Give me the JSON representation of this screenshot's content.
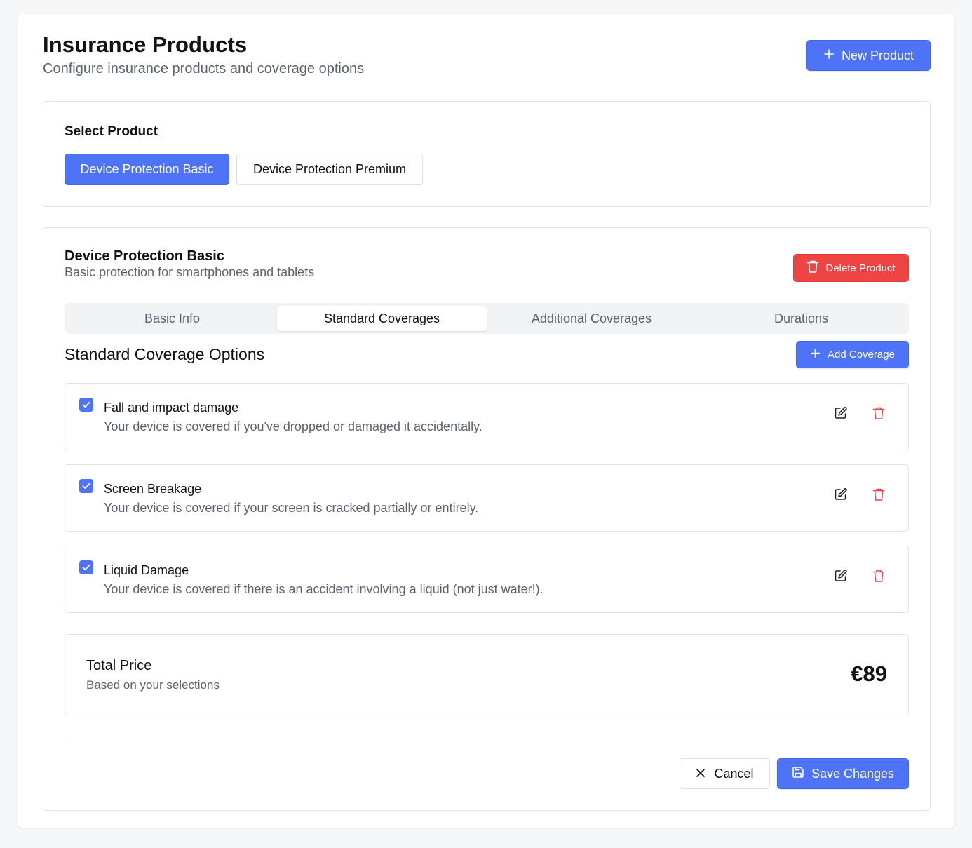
{
  "header": {
    "title": "Insurance Products",
    "subtitle": "Configure insurance products and coverage options",
    "new_product_label": "New Product"
  },
  "select_product": {
    "label": "Select Product",
    "options": [
      "Device Protection Basic",
      "Device Protection Premium"
    ],
    "selected": "Device Protection Basic"
  },
  "product": {
    "name": "Device Protection Basic",
    "description": "Basic protection for smartphones and tablets",
    "delete_label": "Delete Product"
  },
  "tabs": [
    {
      "label": "Basic Info",
      "active": false
    },
    {
      "label": "Standard Coverages",
      "active": true
    },
    {
      "label": "Additional Coverages",
      "active": false
    },
    {
      "label": "Durations",
      "active": false
    }
  ],
  "coverage_section": {
    "title": "Standard Coverage Options",
    "add_label": "Add Coverage",
    "items": [
      {
        "title": "Fall and impact damage",
        "description": "Your device is covered if you've dropped or damaged it accidentally.",
        "checked": true
      },
      {
        "title": "Screen Breakage",
        "description": "Your device is covered if your screen is cracked partially or entirely.",
        "checked": true
      },
      {
        "title": "Liquid Damage",
        "description": "Your device is covered if there is an accident involving a liquid (not just water!).",
        "checked": true
      }
    ]
  },
  "total": {
    "title": "Total Price",
    "subtitle": "Based on your selections",
    "price": "€89"
  },
  "footer": {
    "cancel_label": "Cancel",
    "save_label": "Save Changes"
  },
  "colors": {
    "primary": "#4f73f6",
    "danger": "#ef4444",
    "muted_text": "#5c6370"
  },
  "icons": [
    "plus-icon",
    "trash-icon",
    "check-icon",
    "edit-icon",
    "close-icon",
    "save-icon"
  ]
}
